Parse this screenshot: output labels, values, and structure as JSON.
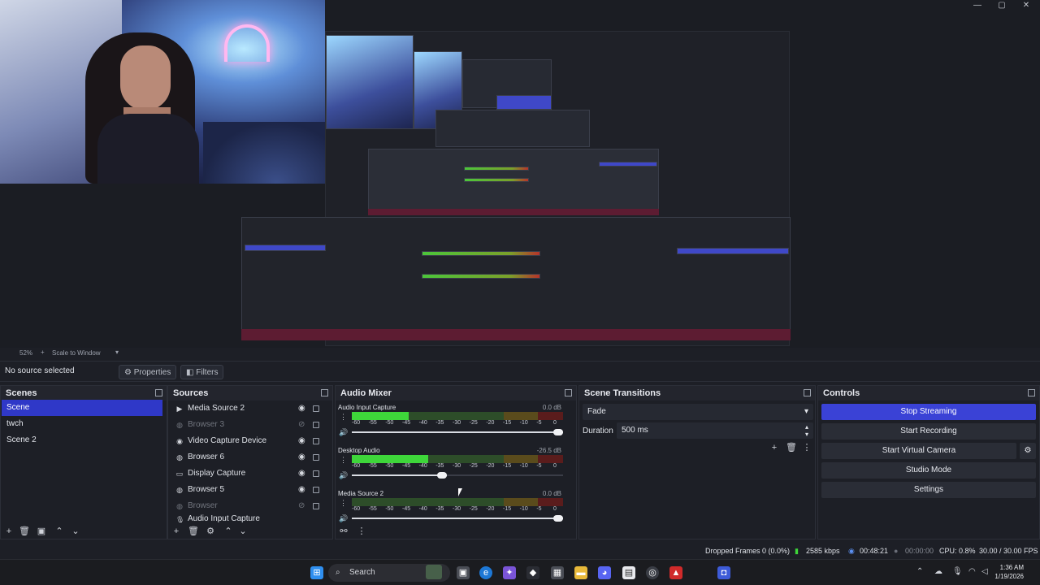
{
  "window": {
    "controls": [
      "—",
      "▢",
      "✕"
    ]
  },
  "preview": {
    "zoom": "52%",
    "scale_mode": "Scale to Window"
  },
  "contextbar": {
    "selection": "No source selected",
    "properties_label": "Properties",
    "filters_label": "Filters"
  },
  "scenes": {
    "title": "Scenes",
    "items": [
      "Scene",
      "twch",
      "Scene 2"
    ]
  },
  "sources": {
    "title": "Sources",
    "items": [
      {
        "name": "Media Source 2",
        "icon": "▶"
      },
      {
        "name": "Browser 3",
        "icon": "◍"
      },
      {
        "name": "Video Capture Device",
        "icon": "◉"
      },
      {
        "name": "Browser 6",
        "icon": "◍"
      },
      {
        "name": "Display Capture",
        "icon": "▭"
      },
      {
        "name": "Browser 5",
        "icon": "◍"
      },
      {
        "name": "Browser",
        "icon": "◍"
      },
      {
        "name": "Audio Input Capture",
        "icon": "🎙"
      }
    ]
  },
  "mixer": {
    "title": "Audio Mixer",
    "scale": [
      "-60",
      "-55",
      "-50",
      "-45",
      "-40",
      "-35",
      "-30",
      "-25",
      "-20",
      "-15",
      "-10",
      "-5",
      "0"
    ],
    "channels": [
      {
        "name": "Audio Input Capture",
        "db": "0.0 dB",
        "level": 0.27,
        "volume": 1.0
      },
      {
        "name": "Desktop Audio",
        "db": "-26.5 dB",
        "level": 0.36,
        "volume": 0.45
      },
      {
        "name": "Media Source 2",
        "db": "0.0 dB",
        "level": 0.0,
        "volume": 1.0
      }
    ]
  },
  "transitions": {
    "title": "Scene Transitions",
    "transition": "Fade",
    "duration_label": "Duration",
    "duration_value": "500 ms"
  },
  "controls": {
    "title": "Controls",
    "buttons": [
      "Stop Streaming",
      "Start Recording",
      "Start Virtual Camera",
      "Studio Mode",
      "Settings"
    ]
  },
  "status": {
    "dropped": "Dropped Frames 0 (0.0%)",
    "bitrate": "2585 kbps",
    "stream_time": "00:48:21",
    "rec_time": "00:00:00",
    "cpu": "CPU: 0.8%",
    "fps": "30.00 / 30.00 FPS"
  },
  "taskbar": {
    "search_placeholder": "Search",
    "time": "1:36 AM",
    "date": "1/19/2026"
  },
  "colors": {
    "accent": "#3a42d6",
    "scene_selected": "#2f38c8",
    "meter_green": "#3ed63a",
    "background": "#1d1f26"
  }
}
